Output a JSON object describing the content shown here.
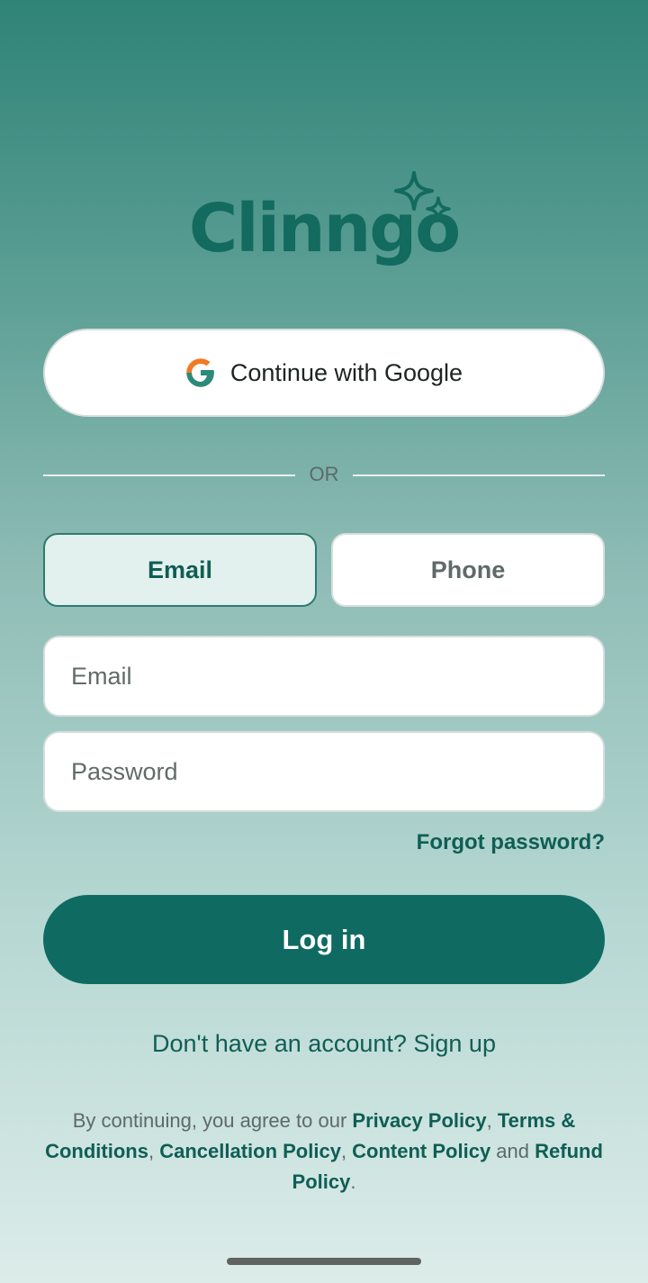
{
  "brand": {
    "logo_text": "Clinngo"
  },
  "google_button": {
    "label": "Continue with Google",
    "icon": "google-g-icon"
  },
  "divider": {
    "label": "OR"
  },
  "tabs": [
    {
      "label": "Email",
      "selected": true
    },
    {
      "label": "Phone",
      "selected": false
    }
  ],
  "form": {
    "email_placeholder": "Email",
    "email_value": "",
    "password_placeholder": "Password",
    "password_value": ""
  },
  "forgot_password": "Forgot password?",
  "login_button": "Log in",
  "signup_prompt": "Don't have an account? Sign up",
  "legal": {
    "prefix": "By continuing, you agree to our ",
    "privacy": "Privacy Policy",
    "sep1": ", ",
    "terms": "Terms & Conditions",
    "sep2": ", ",
    "cancellation": "Cancellation Policy",
    "sep3": ", ",
    "content": "Content Policy",
    "and": " and ",
    "refund": "Refund Policy",
    "end": "."
  },
  "colors": {
    "primary": "#0f6b62",
    "tab_selected_bg": "#e3f1ee",
    "background_top": "#2f8377",
    "background_bottom": "#dcece9"
  }
}
